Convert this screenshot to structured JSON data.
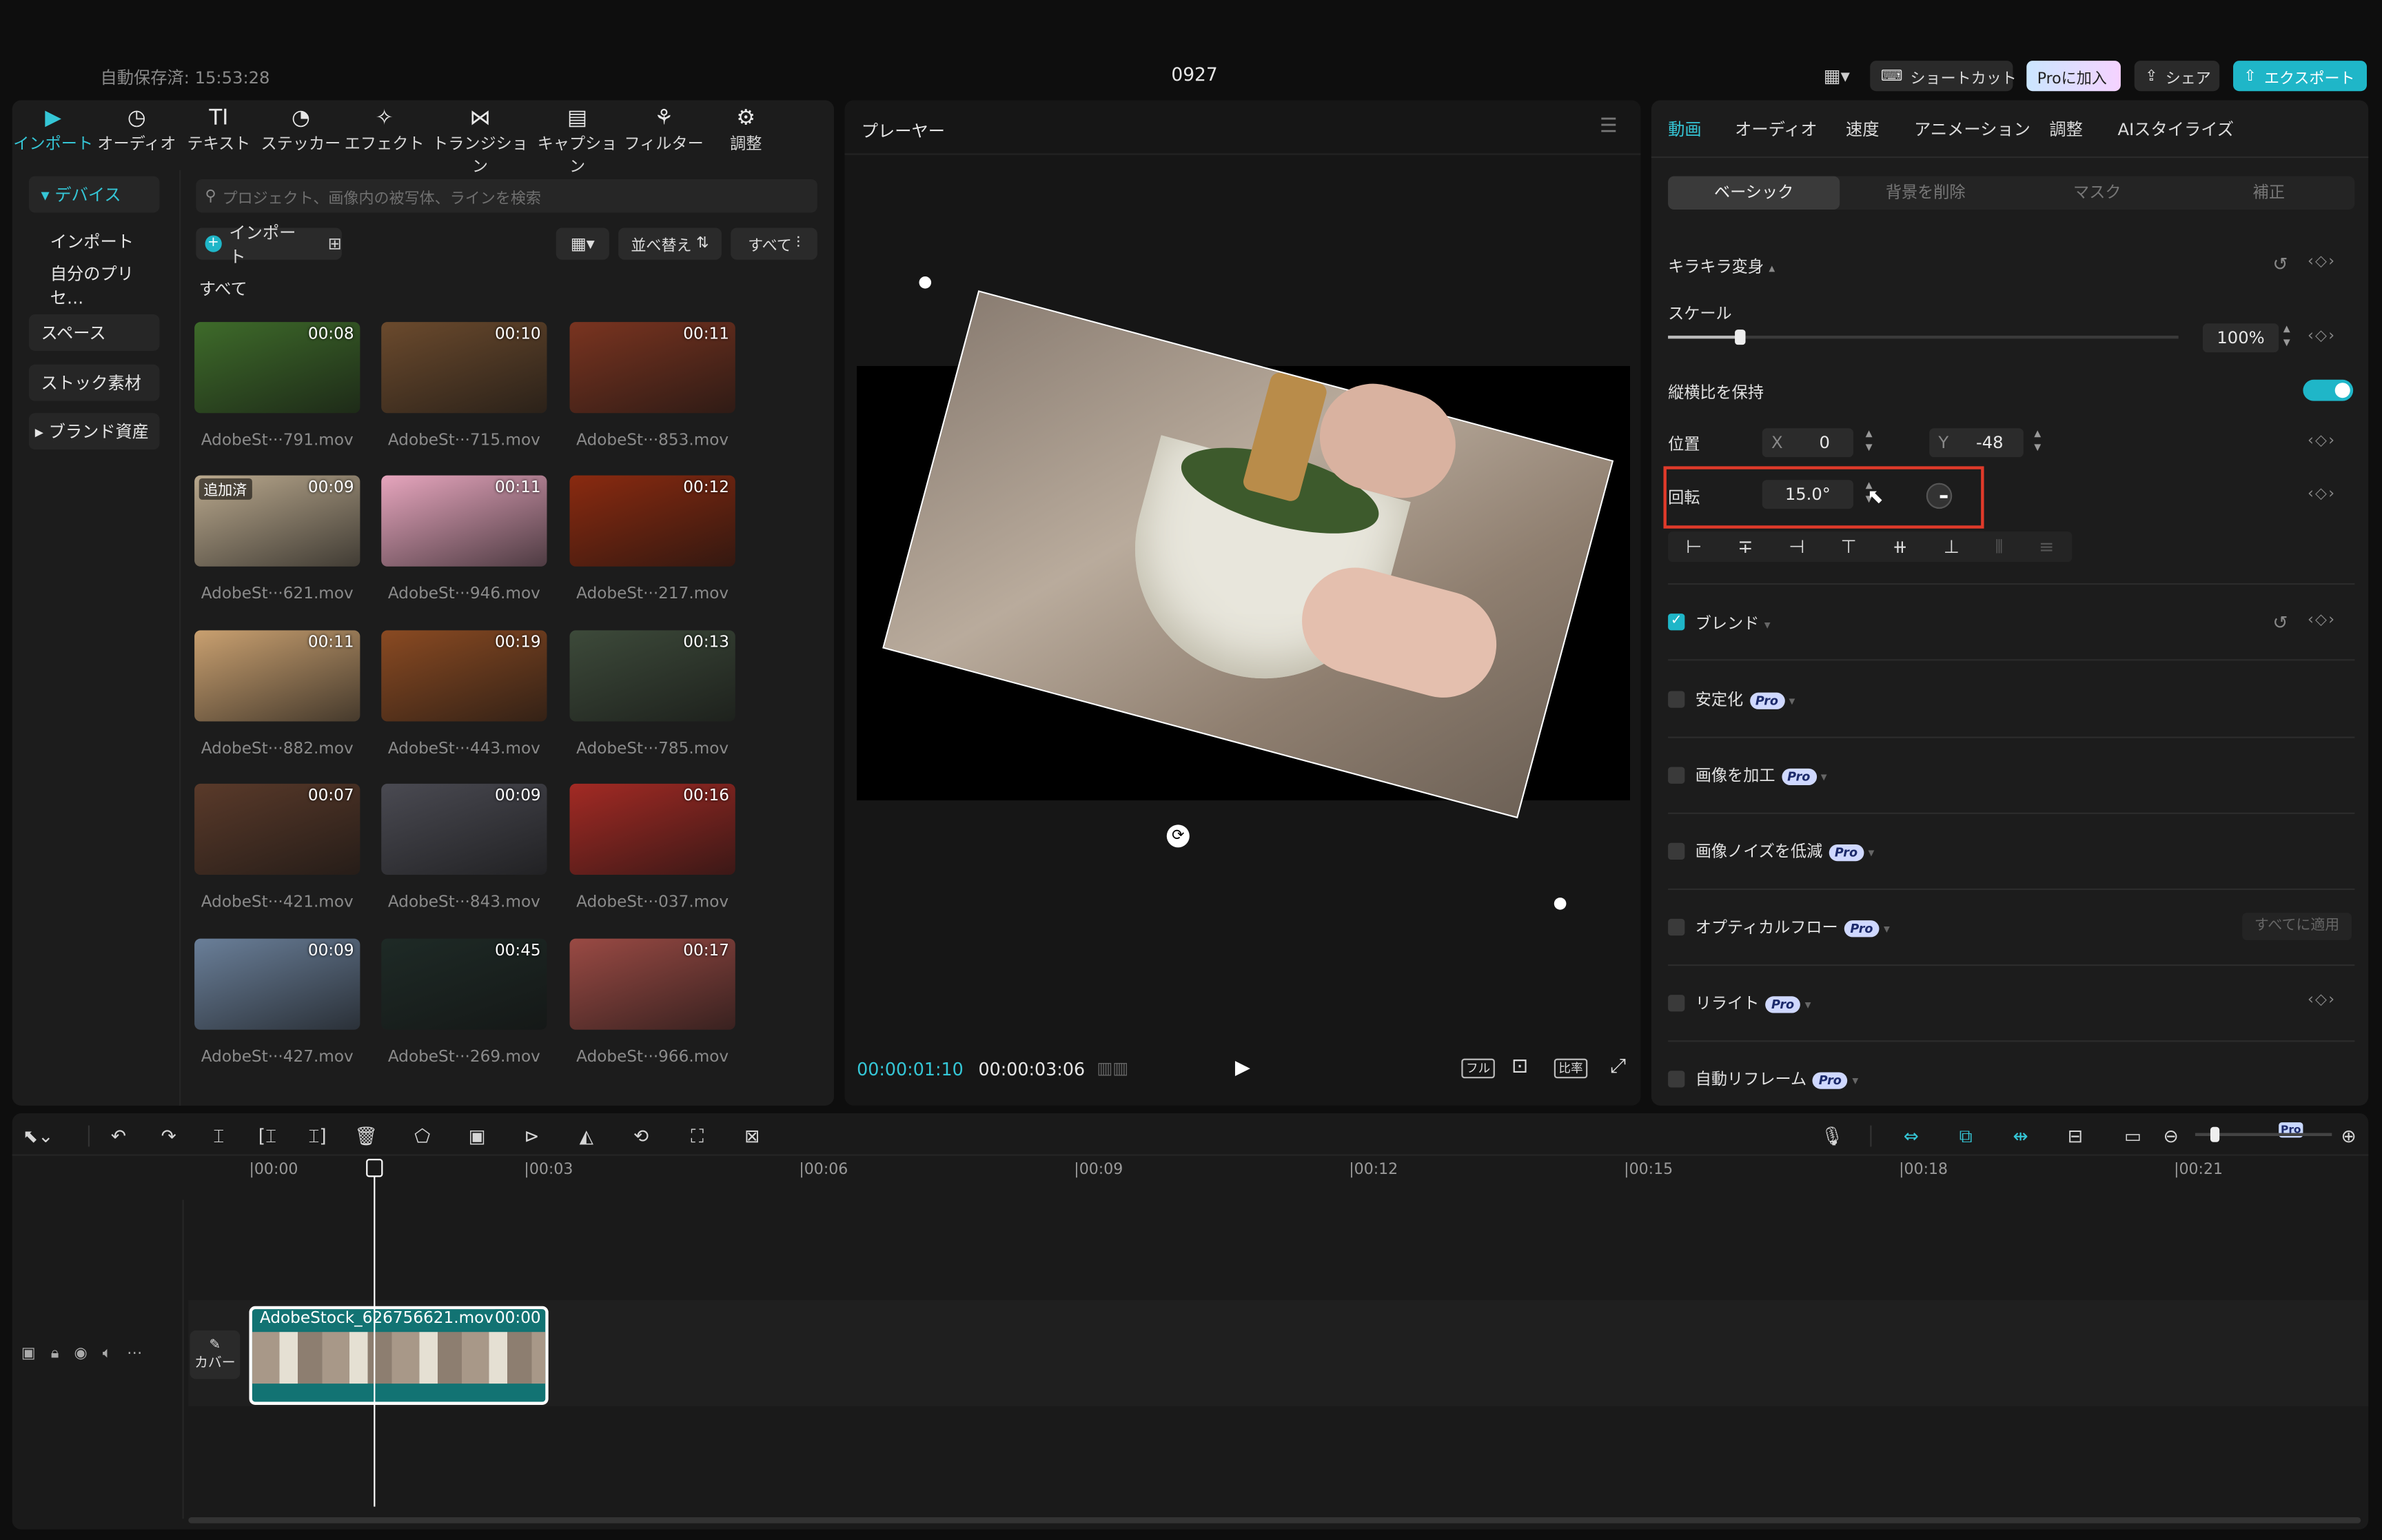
{
  "top": {
    "autosave": "自動保存済: 15:53:28",
    "title": "0927",
    "shortcut": "ショートカット",
    "pro": "Proに加入",
    "share": "シェア",
    "export": "エクスポート"
  },
  "tools": [
    {
      "label": "インポート",
      "glyph": "▶"
    },
    {
      "label": "オーディオ",
      "glyph": "◷"
    },
    {
      "label": "テキスト",
      "glyph": "TI"
    },
    {
      "label": "ステッカー",
      "glyph": "◔"
    },
    {
      "label": "エフェクト",
      "glyph": "✧"
    },
    {
      "label": "トランジション",
      "glyph": "⋈"
    },
    {
      "label": "キャプション",
      "glyph": "▤"
    },
    {
      "label": "フィルター",
      "glyph": "⚘"
    },
    {
      "label": "調整",
      "glyph": "⚙"
    }
  ],
  "side": {
    "device": "▾ デバイス",
    "import": "インポート",
    "preset": "自分のプリセ…",
    "space": "スペース",
    "stock": "ストック素材",
    "brand": "▸ ブランド資産"
  },
  "media": {
    "search_placeholder": "プロジェクト、画像内の被写体、ラインを検索",
    "import": "インポート",
    "sort": "並べ替え",
    "all_filter": "すべて",
    "section": "すべて",
    "added": "追加済",
    "items": [
      {
        "d": "00:08",
        "n": "AdobeSt···791.mov",
        "c": "#3e6b2a"
      },
      {
        "d": "00:10",
        "n": "AdobeSt···715.mov",
        "c": "#6b4a2d"
      },
      {
        "d": "00:11",
        "n": "AdobeSt···853.mov",
        "c": "#7a3420"
      },
      {
        "d": "00:09",
        "n": "AdobeSt···621.mov",
        "c": "#b9a88d"
      },
      {
        "d": "00:11",
        "n": "AdobeSt···946.mov",
        "c": "#e6a5bd"
      },
      {
        "d": "00:12",
        "n": "AdobeSt···217.mov",
        "c": "#8a2a10"
      },
      {
        "d": "00:11",
        "n": "AdobeSt···882.mov",
        "c": "#c9a070"
      },
      {
        "d": "00:19",
        "n": "AdobeSt···443.mov",
        "c": "#8a4a22"
      },
      {
        "d": "00:13",
        "n": "AdobeSt···785.mov",
        "c": "#3d4a3a"
      },
      {
        "d": "00:07",
        "n": "AdobeSt···421.mov",
        "c": "#5a3a2a"
      },
      {
        "d": "00:09",
        "n": "AdobeSt···843.mov",
        "c": "#4a4a52"
      },
      {
        "d": "00:16",
        "n": "AdobeSt···037.mov",
        "c": "#a32a24"
      },
      {
        "d": "00:09",
        "n": "AdobeSt···427.mov",
        "c": "#6a7f99"
      },
      {
        "d": "00:45",
        "n": "AdobeSt···269.mov",
        "c": "#1e2a26"
      },
      {
        "d": "00:17",
        "n": "AdobeSt···966.mov",
        "c": "#9a4a44"
      }
    ]
  },
  "player": {
    "title": "プレーヤー",
    "current": "00:00:01:10",
    "total": "00:00:03:06",
    "full": "フル",
    "ratio": "比率"
  },
  "right": {
    "tabs": [
      "動画",
      "オーディオ",
      "速度",
      "アニメーション",
      "調整",
      "AIスタイライズ"
    ],
    "subtabs": [
      "ベーシック",
      "背景を削除",
      "マスク",
      "補正"
    ],
    "transform": "キラキラ変身",
    "scale_label": "スケール",
    "scale_value": "100%",
    "scale_level": 0.14,
    "keep_ratio": "縦横比を保持",
    "position": "位置",
    "x_label": "X",
    "x": "0",
    "y_label": "Y",
    "y": "-48",
    "rotate": "回転",
    "rotate_value": "15.0°",
    "blend": "ブレンド",
    "stabilize": "安定化",
    "enhance": "画像を加工",
    "denoise": "画像ノイズを低減",
    "optical": "オプティカルフロー",
    "apply_all": "すべてに適用",
    "relight": "リライト",
    "reframe": "自動リフレーム",
    "pro_badge": "Pro"
  },
  "timeline": {
    "ticks": [
      "|00:00",
      "|00:03",
      "|00:06",
      "|00:09",
      "|00:12",
      "|00:15",
      "|00:18",
      "|00:21"
    ],
    "clip_name": "AdobeStock_626756621.mov",
    "clip_dur": "00:00",
    "cover": "カバー",
    "pro_badge": "Pro"
  }
}
